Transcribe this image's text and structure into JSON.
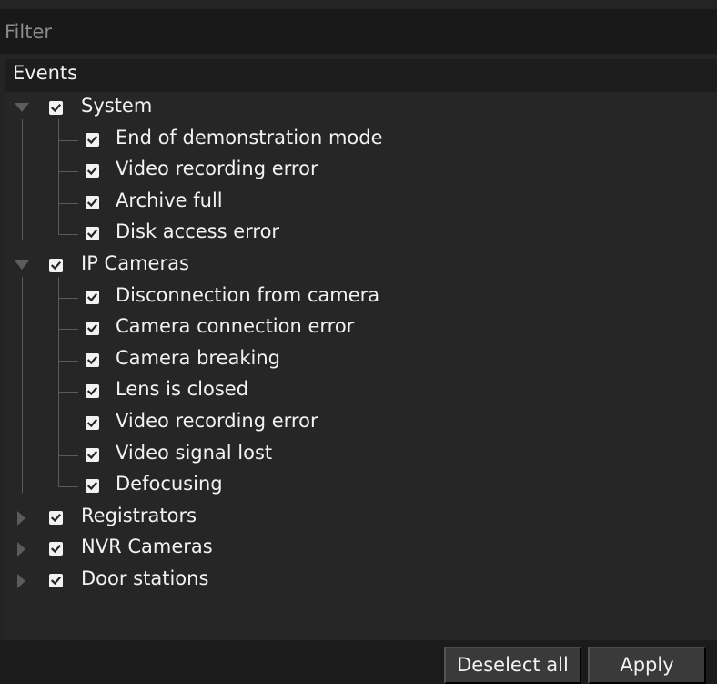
{
  "filter": {
    "placeholder": "Filter",
    "value": ""
  },
  "tree": {
    "header": "Events",
    "groups": [
      {
        "label": "System",
        "expanded": true,
        "checked": true,
        "items": [
          "End of demonstration mode",
          "Video recording error",
          "Archive full",
          "Disk access error"
        ]
      },
      {
        "label": "IP Cameras",
        "expanded": true,
        "checked": true,
        "items": [
          "Disconnection from camera",
          "Camera connection error",
          "Camera breaking",
          "Lens is closed",
          "Video recording error",
          "Video signal lost",
          "Defocusing"
        ]
      },
      {
        "label": "Registrators",
        "expanded": false,
        "checked": true,
        "items": []
      },
      {
        "label": "NVR Cameras",
        "expanded": false,
        "checked": true,
        "items": []
      },
      {
        "label": "Door stations",
        "expanded": false,
        "checked": true,
        "items": []
      }
    ]
  },
  "buttons": {
    "deselect_all": "Deselect all",
    "apply": "Apply"
  },
  "icons": {
    "expanded": "expand-down-arrow-icon",
    "collapsed": "expand-right-arrow-icon",
    "checkbox": "checkbox-checked-icon"
  },
  "colors": {
    "background": "#242424",
    "header": "#1d1d1d",
    "button": "#3a3a3a",
    "text": "#f2f2f2"
  }
}
